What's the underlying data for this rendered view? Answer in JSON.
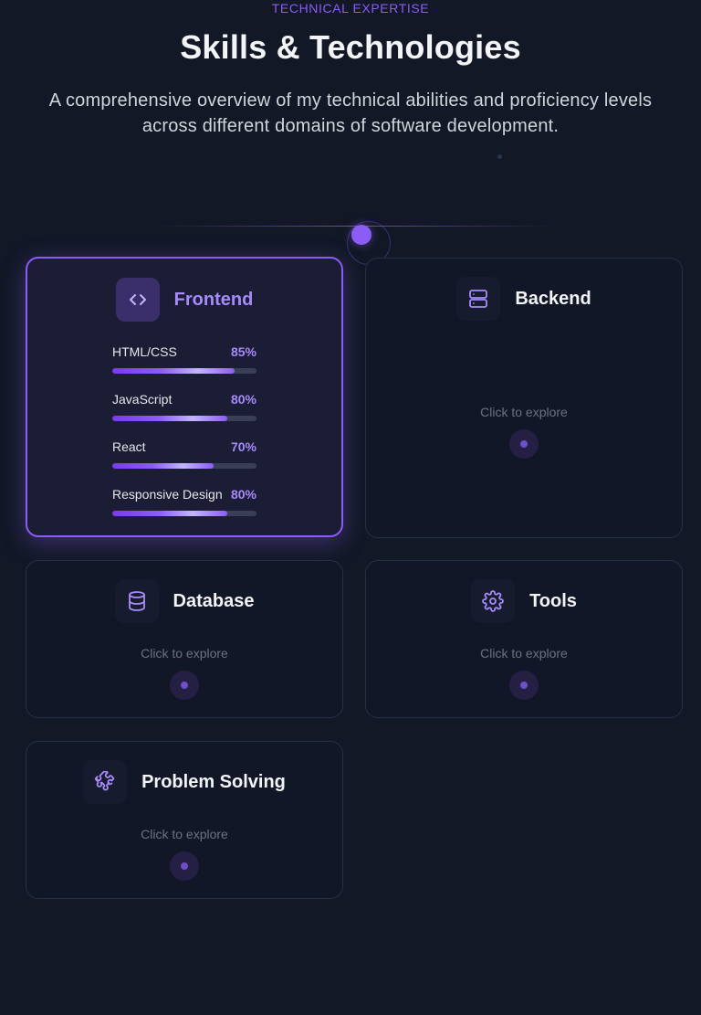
{
  "header": {
    "eyebrow": "TECHNICAL EXPERTISE",
    "title": "Skills & Technologies",
    "subtitle": "A comprehensive overview of my technical abilities and proficiency levels across different domains of software development."
  },
  "colors": {
    "accent": "#8b5cf6",
    "accent_light": "#a78bfa",
    "background": "#121826",
    "card": "#111726"
  },
  "cards": [
    {
      "title": "Frontend",
      "icon": "code-icon",
      "active": true,
      "skills": [
        {
          "name": "HTML/CSS",
          "percent_label": "85%",
          "level": 0.85
        },
        {
          "name": "JavaScript",
          "percent_label": "80%",
          "level": 0.8
        },
        {
          "name": "React",
          "percent_label": "70%",
          "level": 0.7
        },
        {
          "name": "Responsive Design",
          "percent_label": "80%",
          "level": 0.8
        }
      ]
    },
    {
      "title": "Backend",
      "icon": "server-icon",
      "active": false,
      "explore": "Click to explore"
    },
    {
      "title": "Database",
      "icon": "database-icon",
      "active": false,
      "explore": "Click to explore"
    },
    {
      "title": "Tools",
      "icon": "gear-icon",
      "active": false,
      "explore": "Click to explore"
    },
    {
      "title": "Problem Solving",
      "icon": "puzzle-icon",
      "active": false,
      "explore": "Click to explore"
    }
  ]
}
